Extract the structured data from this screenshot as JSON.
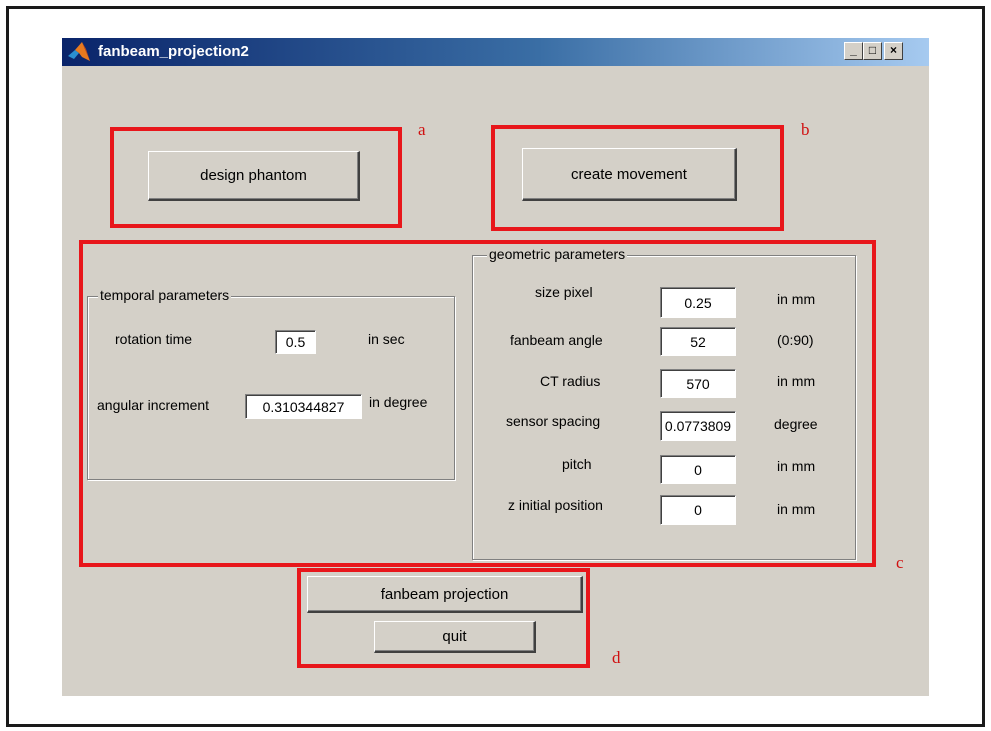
{
  "window": {
    "title": "fanbeam_projection2",
    "controls": {
      "minimize": "_",
      "maximize": "□",
      "close": "×"
    }
  },
  "buttons": {
    "design_phantom": "design phantom",
    "create_movement": "create movement",
    "fanbeam_projection": "fanbeam projection",
    "quit": "quit"
  },
  "temporal": {
    "title": "temporal parameters",
    "rotation_time": {
      "label": "rotation time",
      "value": "0.5",
      "unit": "in sec"
    },
    "angular_increment": {
      "label": "angular increment",
      "value": "0.310344827",
      "unit": "in degree"
    }
  },
  "geometric": {
    "title": "geometric  parameters",
    "rows": [
      {
        "label": "size pixel",
        "value": "0.25",
        "unit": "in mm"
      },
      {
        "label": "fanbeam angle",
        "value": "52",
        "unit": "(0:90)"
      },
      {
        "label": "CT radius",
        "value": "570",
        "unit": "in mm"
      },
      {
        "label": "sensor spacing",
        "value": "0.0773809",
        "unit": "degree"
      },
      {
        "label": "pitch",
        "value": "0",
        "unit": "in mm"
      },
      {
        "label": "z initial position",
        "value": "0",
        "unit": "in mm"
      }
    ]
  },
  "annotations": {
    "a": "a",
    "b": "b",
    "c": "c",
    "d": "d"
  },
  "colors": {
    "annotation_red": "#e8161b",
    "window_bg": "#d4d0c8",
    "titlebar": "#0a246a"
  },
  "icons": {
    "app": "matlab-logo-icon"
  }
}
